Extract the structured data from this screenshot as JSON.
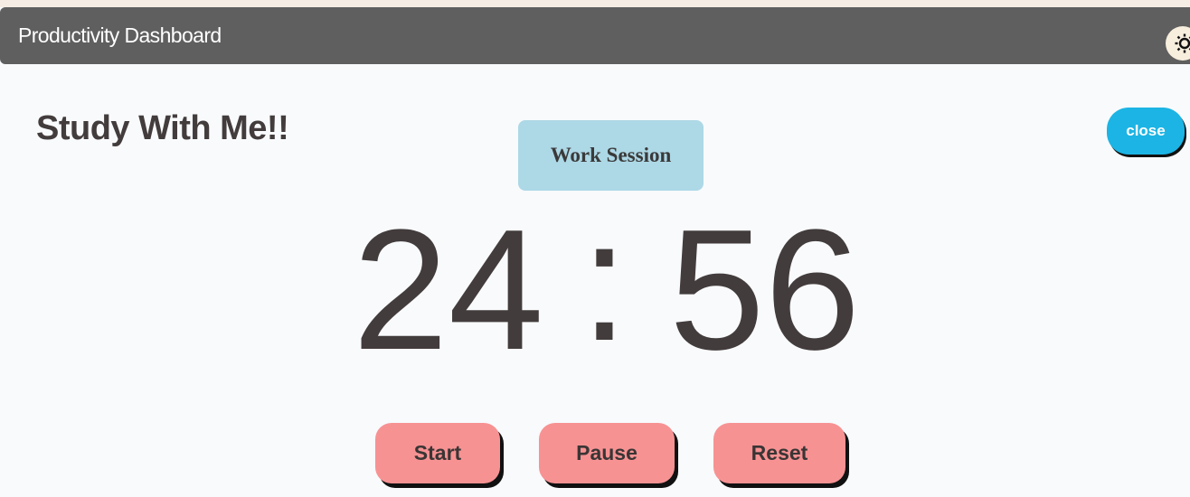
{
  "header": {
    "title": "Productivity Dashboard",
    "theme_toggle_icon": "sun-icon"
  },
  "main": {
    "title": "Study With Me!!",
    "session_label": "Work Session",
    "close_label": "close",
    "timer": {
      "minutes": "24",
      "separator": ":",
      "seconds": "56"
    },
    "controls": {
      "start_label": "Start",
      "pause_label": "Pause",
      "reset_label": "Reset"
    }
  },
  "colors": {
    "header_bg": "#5f5f5f",
    "session_bg": "#add8e6",
    "close_bg": "#1cb4e4",
    "control_bg": "#f79293",
    "text_dark": "#433c3c"
  }
}
